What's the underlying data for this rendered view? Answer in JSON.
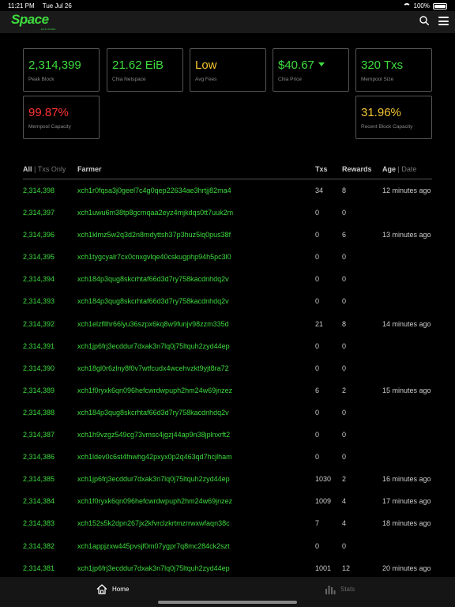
{
  "status_bar": {
    "time": "11:21 PM",
    "date": "Tue Jul 26",
    "battery": "100%"
  },
  "app": {
    "logo": "Space",
    "logo_sub": "EXPLORER"
  },
  "colors": {
    "accent": "#3ddc3d",
    "red": "#ff3333",
    "yellow": "#f4c430",
    "background": "#000000"
  },
  "stats": [
    {
      "value": "2,314,399",
      "label": "Peak Block",
      "color": "#3ddc3d"
    },
    {
      "value": "21.62 EiB",
      "label": "Chia Netspace",
      "color": "#3ddc3d"
    },
    {
      "value": "Low",
      "label": "Avg Fees",
      "color": "#f4c430"
    },
    {
      "value": "$40.67",
      "label": "Chia Price",
      "color": "#3ddc3d"
    },
    {
      "value": "320 Txs",
      "label": "Mempool Size",
      "color": "#3ddc3d"
    },
    {
      "value": "99.87%",
      "label": "Mempool Capacity",
      "color": "#ff3333"
    },
    {
      "value": "31.96%",
      "label": "Recent Block Capacity",
      "color": "#f4c430"
    }
  ],
  "table": {
    "filter_all": "All",
    "filter_sep": "|",
    "filter_txs_only": "Txs Only",
    "col_farmer": "Farmer",
    "col_txs": "Txs",
    "col_rewards": "Rewards",
    "col_age": "Age",
    "col_date": "Date",
    "rows": [
      {
        "block": "2,314,398",
        "farmer": "xch1r0fqsa3j0geel7c4g0qep22634ae3hrtjj82ma4",
        "txs": "34",
        "rewards": "8",
        "age": "12 minutes ago"
      },
      {
        "block": "2,314,397",
        "farmer": "xch1uwu6m38tp8gcmqaa2eyz4mjkdqs0tt7uuk2m",
        "txs": "0",
        "rewards": "0",
        "age": ""
      },
      {
        "block": "2,314,396",
        "farmer": "xch1klmz5w2q3d2n8mdyttsh37p3huz5lq0pus38f",
        "txs": "0",
        "rewards": "6",
        "age": "13 minutes ago"
      },
      {
        "block": "2,314,395",
        "farmer": "xch1tygcyalr7cx0cnxgvlqe40cskugphp94h5pc3l0",
        "txs": "0",
        "rewards": "0",
        "age": ""
      },
      {
        "block": "2,314,394",
        "farmer": "xch184p3qug8skcrhtaf66d3d7ry758kacdnhdq2v",
        "txs": "0",
        "rewards": "0",
        "age": ""
      },
      {
        "block": "2,314,393",
        "farmer": "xch184p3qug8skcrhtaf66d3d7ry758kacdnhdq2v",
        "txs": "0",
        "rewards": "0",
        "age": ""
      },
      {
        "block": "2,314,392",
        "farmer": "xch1elzfllhr66lyu36szpx6kq8w9funjv98zzm335d",
        "txs": "21",
        "rewards": "8",
        "age": "14 minutes ago"
      },
      {
        "block": "2,314,391",
        "farmer": "xch1jp6frj3ecddur7dxak3n7lq0j75ltquh2zyd44ep",
        "txs": "0",
        "rewards": "0",
        "age": ""
      },
      {
        "block": "2,314,390",
        "farmer": "xch18gl0r6zlny8f0v7wtfcudx4wcehvzkt9yjt8ra72",
        "txs": "0",
        "rewards": "0",
        "age": ""
      },
      {
        "block": "2,314,389",
        "farmer": "xch1f0ryxk6qn096hefcwrdwpuph2hm24w69jnzez",
        "txs": "6",
        "rewards": "2",
        "age": "15 minutes ago"
      },
      {
        "block": "2,314,388",
        "farmer": "xch184p3qug8skcrhtaf66d3d7ry758kacdnhdq2v",
        "txs": "0",
        "rewards": "0",
        "age": ""
      },
      {
        "block": "2,314,387",
        "farmer": "xch1h9vzgz549cg73vmsc4jgzj44ap9n38jplnxrft2",
        "txs": "0",
        "rewards": "0",
        "age": ""
      },
      {
        "block": "2,314,386",
        "farmer": "xch1ldev0c6st4fnwhg42pxyx0p2q463qd7hcjlham",
        "txs": "0",
        "rewards": "0",
        "age": ""
      },
      {
        "block": "2,314,385",
        "farmer": "xch1jp6frj3ecddur7dxak3n7lq0j75ltquh2zyd44ep",
        "txs": "1030",
        "rewards": "2",
        "age": "16 minutes ago"
      },
      {
        "block": "2,314,384",
        "farmer": "xch1f0ryxk6qn096hefcwrdwpuph2hm24w69jnzez",
        "txs": "1009",
        "rewards": "4",
        "age": "17 minutes ago"
      },
      {
        "block": "2,314,383",
        "farmer": "xch152s5k2dpn267jx2kfvrclzkrtmzrrwxwfaqn38c",
        "txs": "7",
        "rewards": "4",
        "age": "18 minutes ago"
      },
      {
        "block": "2,314,382",
        "farmer": "xch1appjzxw445pvsjf0m07ygpr7q8mc284ck2szt",
        "txs": "0",
        "rewards": "0",
        "age": ""
      },
      {
        "block": "2,314,381",
        "farmer": "xch1jp6frj3ecddur7dxak3n7lq0j75ltquh2zyd44ep",
        "txs": "1001",
        "rewards": "12",
        "age": "20 minutes ago"
      }
    ]
  },
  "tabs": {
    "home": "Home",
    "stats": "Stats"
  }
}
